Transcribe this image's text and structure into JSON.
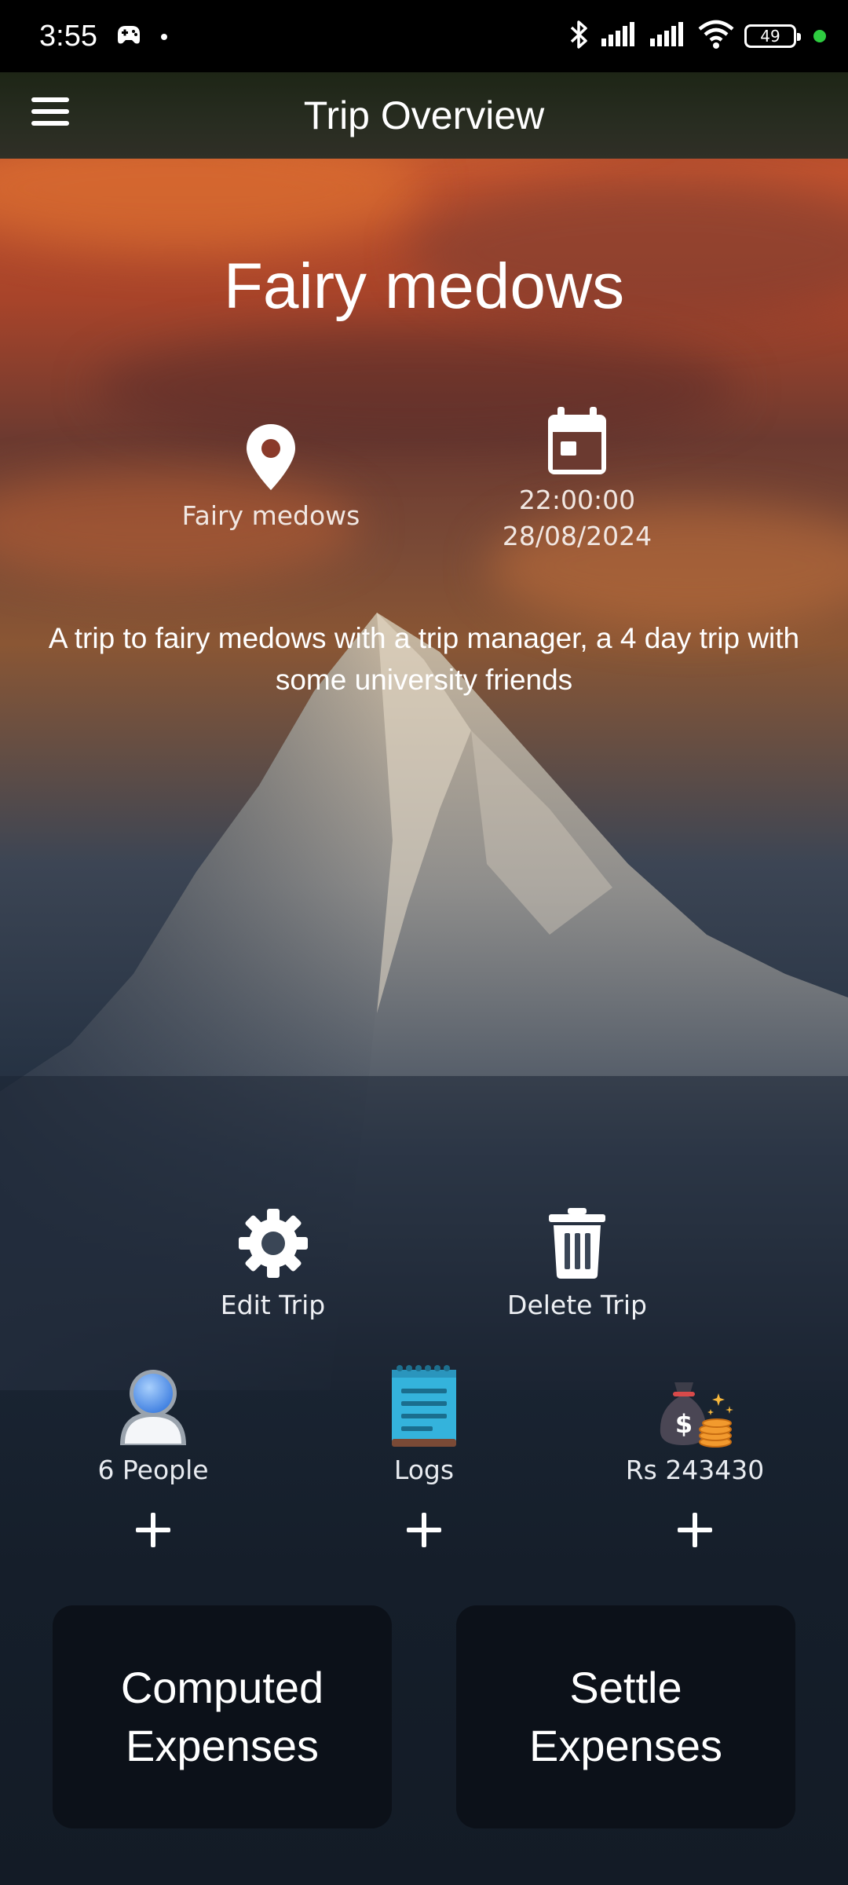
{
  "status_bar": {
    "time": "3:55",
    "battery": "49",
    "icons": [
      "game-controller-icon",
      "dot-icon",
      "bluetooth-icon",
      "signal-icon",
      "signal-icon",
      "wifi-icon",
      "battery-icon",
      "green-dot-icon"
    ]
  },
  "app_bar": {
    "title": "Trip Overview",
    "menu_icon": "hamburger-menu-icon"
  },
  "trip": {
    "title": "Fairy medows",
    "location": "Fairy medows",
    "time": "22:00:00",
    "date": "28/08/2024",
    "description": "A trip to fairy medows with a trip manager, a 4 day trip with some university friends"
  },
  "actions": {
    "edit_label": "Edit Trip",
    "delete_label": "Delete Trip"
  },
  "stats": {
    "people_label": "6 People",
    "logs_label": "Logs",
    "money_label": "Rs 243430"
  },
  "buttons": {
    "computed_expenses": "Computed Expenses",
    "settle_expenses": "Settle Expenses"
  },
  "colors": {
    "status_bar_bg": "#000000",
    "button_bg": "#0c1119",
    "battery_dot": "#2ecc40",
    "text": "#ffffff"
  }
}
